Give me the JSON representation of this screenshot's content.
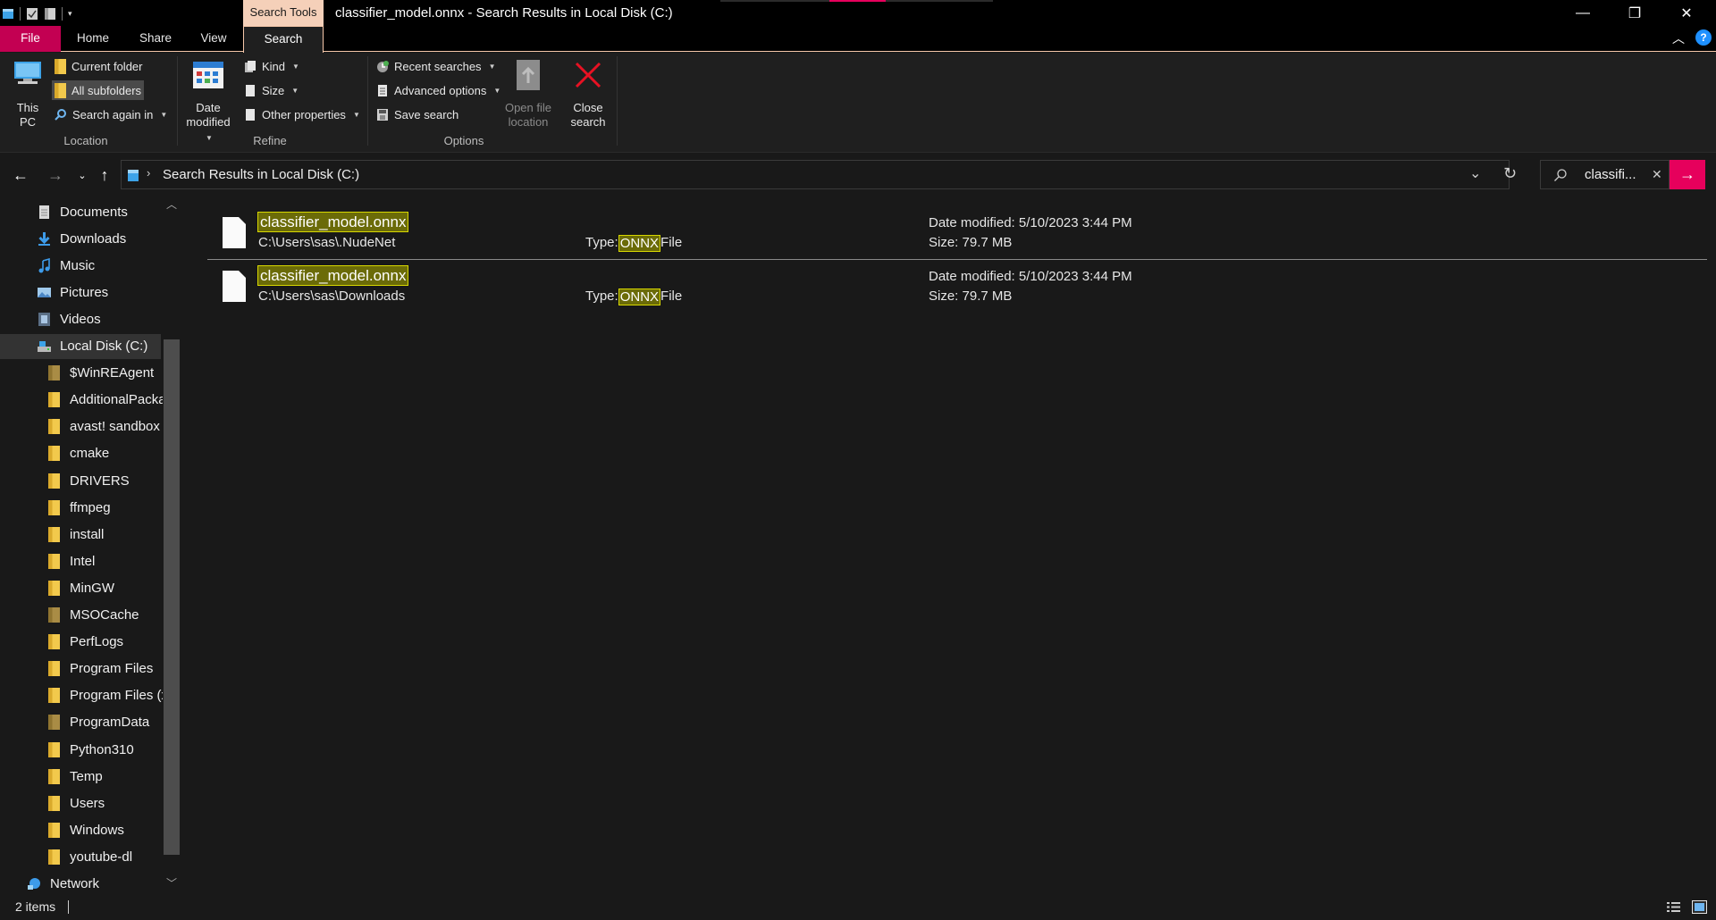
{
  "titlebar": {
    "context_tab": "Search Tools",
    "title": "classifier_model.onnx - Search Results in Local Disk (C:)",
    "minimize": "—",
    "maximize": "❐",
    "close": "✕"
  },
  "tabs": {
    "file": "File",
    "home": "Home",
    "share": "Share",
    "view": "View",
    "search": "Search",
    "help": "?"
  },
  "ribbon": {
    "location": {
      "group_label": "Location",
      "this_pc": "This PC",
      "current_folder": "Current folder",
      "all_subfolders": "All subfolders",
      "search_again_in": "Search again in"
    },
    "refine": {
      "group_label": "Refine",
      "date_modified_1": "Date",
      "date_modified_2": "modified",
      "kind": "Kind",
      "size": "Size",
      "other_properties": "Other properties"
    },
    "options": {
      "group_label": "Options",
      "recent_searches": "Recent searches",
      "advanced_options": "Advanced options",
      "save_search": "Save search",
      "open_file_location_1": "Open file",
      "open_file_location_2": "location",
      "close_search_1": "Close",
      "close_search_2": "search"
    }
  },
  "address": {
    "path": "Search Results in Local Disk (C:)",
    "search_query": "classifi..."
  },
  "nav": {
    "items": [
      {
        "label": "Documents",
        "icon": "documents-icon"
      },
      {
        "label": "Downloads",
        "icon": "downloads-icon"
      },
      {
        "label": "Music",
        "icon": "music-icon"
      },
      {
        "label": "Pictures",
        "icon": "pictures-icon"
      },
      {
        "label": "Videos",
        "icon": "videos-icon"
      },
      {
        "label": "Local Disk (C:)",
        "icon": "drive-icon"
      },
      {
        "label": "$WinREAgent",
        "icon": "folder-icon"
      },
      {
        "label": "AdditionalPacka",
        "icon": "folder-icon"
      },
      {
        "label": "avast! sandbox",
        "icon": "folder-icon"
      },
      {
        "label": "cmake",
        "icon": "folder-icon"
      },
      {
        "label": "DRIVERS",
        "icon": "folder-icon"
      },
      {
        "label": "ffmpeg",
        "icon": "folder-icon"
      },
      {
        "label": "install",
        "icon": "folder-icon"
      },
      {
        "label": "Intel",
        "icon": "folder-icon"
      },
      {
        "label": "MinGW",
        "icon": "folder-icon"
      },
      {
        "label": "MSOCache",
        "icon": "folder-icon"
      },
      {
        "label": "PerfLogs",
        "icon": "folder-icon"
      },
      {
        "label": "Program Files",
        "icon": "folder-icon"
      },
      {
        "label": "Program Files (x",
        "icon": "folder-icon"
      },
      {
        "label": "ProgramData",
        "icon": "folder-icon"
      },
      {
        "label": "Python310",
        "icon": "folder-icon"
      },
      {
        "label": "Temp",
        "icon": "folder-icon"
      },
      {
        "label": "Users",
        "icon": "folder-icon"
      },
      {
        "label": "Windows",
        "icon": "folder-icon"
      },
      {
        "label": "youtube-dl",
        "icon": "folder-icon"
      },
      {
        "label": "Network",
        "icon": "network-icon"
      }
    ]
  },
  "results": [
    {
      "name": "classifier_model.onnx",
      "path": "C:\\Users\\sas\\.NudeNet",
      "type_prefix": "Type:",
      "type_highlight": "ONNX",
      "type_suffix": "File",
      "date_modified": "Date modified: 5/10/2023 3:44 PM",
      "size": "Size: 79.7 MB"
    },
    {
      "name": "classifier_model.onnx",
      "path": "C:\\Users\\sas\\Downloads",
      "type_prefix": "Type:",
      "type_highlight": "ONNX",
      "type_suffix": "File",
      "date_modified": "Date modified: 5/10/2023 3:44 PM",
      "size": "Size: 79.7 MB"
    }
  ],
  "status": {
    "item_count": "2 items"
  },
  "colors": {
    "accent": "#e6005c",
    "file_tab": "#c30052",
    "search_tools": "#f5d0b9",
    "highlight_bg": "#6b6b08",
    "highlight_border": "#d8d800"
  }
}
